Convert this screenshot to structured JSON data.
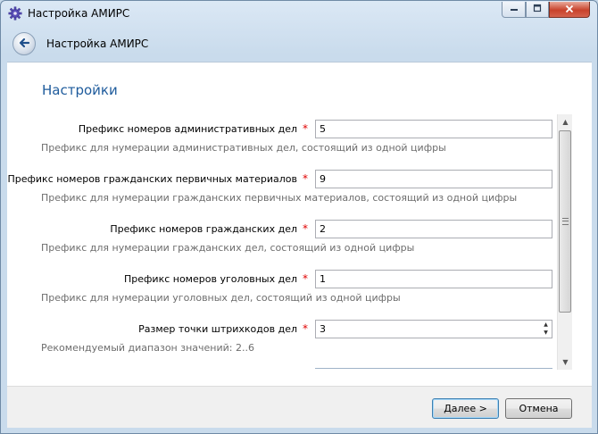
{
  "window": {
    "title": "Настройка АМИРС",
    "icons": {
      "app": "gear-icon",
      "minimize": "minimize-icon",
      "maximize": "maximize-icon",
      "close": "close-icon"
    }
  },
  "nav": {
    "back_icon": "back-arrow-icon",
    "title": "Настройка АМИРС"
  },
  "section": {
    "title": "Настройки"
  },
  "fields": [
    {
      "label": "Префикс номеров административных дел",
      "value": "5",
      "hint": "Префикс для нумерации административных дел, состоящий из одной цифры"
    },
    {
      "label": "Префикс номеров гражданских первичных материалов",
      "value": "9",
      "hint": "Префикс для нумерации гражданских первичных материалов, состоящий из одной цифры"
    },
    {
      "label": "Префикс номеров гражданских дел",
      "value": "2",
      "hint": "Префикс для нумерации гражданских дел, состоящий из одной цифры"
    },
    {
      "label": "Префикс номеров уголовных дел",
      "value": "1",
      "hint": "Префикс для нумерации уголовных дел, состоящий из одной цифры"
    },
    {
      "label": "Размер точки штрихкодов дел",
      "value": "3",
      "hint": "Рекомендуемый диапазон значений: 2..6"
    }
  ],
  "required_mark": "*",
  "footer": {
    "next_label": "Далее >",
    "cancel_label": "Отмена"
  },
  "colors": {
    "section_title": "#1e5b9c",
    "required": "#e00000",
    "window_frame": "#c9dbec"
  }
}
